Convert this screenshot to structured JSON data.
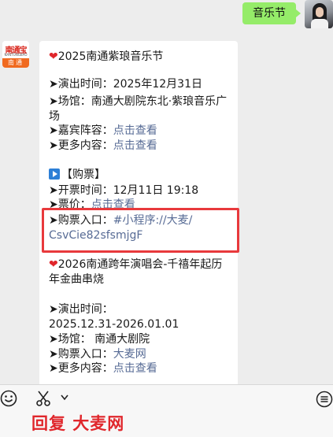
{
  "user_message": {
    "text": "音乐节"
  },
  "bot": {
    "avatar_brand": "南通宝",
    "avatar_sub": "NANTONGBAO",
    "avatar_city": "南通"
  },
  "message": {
    "event1_title": "2025南通紫琅音乐节",
    "event1_time": "➤演出时间：2025年12月31日",
    "event1_venue_1": "➤场馆：南通大剧院东北·紫琅音乐广",
    "event1_venue_2": "场",
    "event1_guests_label": "➤嘉宾阵容：",
    "event1_guests_link": "点击查看",
    "event1_more_label": "➤更多内容：",
    "event1_more_link": "点击查看",
    "ticket_header": "【购票】",
    "ticket_open": "➤开票时间：12月11日 19:18",
    "ticket_price_label": "➤票价：",
    "ticket_price_link": "点击查看",
    "ticket_entry_label": "➤购票入口：",
    "ticket_entry_link_1": "#小程序://大麦/",
    "ticket_entry_link_2": "CsvCie82sfsmjgF",
    "event2_title_1": "2026南通跨年演唱会-千禧年起历",
    "event2_title_2": "年金曲串烧",
    "event2_time_label": "➤演出时间：",
    "event2_time_value": "2025.12.31-2026.01.01",
    "event2_venue": "➤场馆：  南通大剧院",
    "event2_entry_label": "➤购票入口：",
    "event2_entry_link": "大麦网",
    "event2_more_label": "➤更多内容：",
    "event2_more_link": "点击查看"
  },
  "caption": "回复 大麦网",
  "colors": {
    "accent_red": "#e0262b",
    "link": "#576b95",
    "user_bubble": "#95ec69"
  },
  "icons": [
    "emoji-icon",
    "scissors-icon",
    "chevron-down-icon",
    "menu-icon",
    "heart-icon",
    "play-icon"
  ]
}
